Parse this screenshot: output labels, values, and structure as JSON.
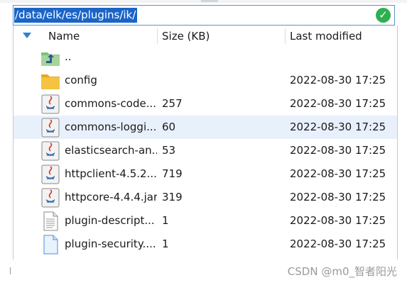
{
  "path": {
    "value": "/data/elk/es/plugins/ik/"
  },
  "columns": {
    "name": "Name",
    "size": "Size (KB)",
    "modified": "Last modified"
  },
  "files": [
    {
      "name": "..",
      "size": "",
      "modified": "",
      "icon": "parent-folder-icon"
    },
    {
      "name": "config",
      "size": "",
      "modified": "2022-08-30 17:25",
      "icon": "folder-icon"
    },
    {
      "name": "commons-code...",
      "size": "257",
      "modified": "2022-08-30 17:25",
      "icon": "java-file-icon"
    },
    {
      "name": "commons-loggi...",
      "size": "60",
      "modified": "2022-08-30 17:25",
      "icon": "java-file-icon"
    },
    {
      "name": "elasticsearch-an...",
      "size": "53",
      "modified": "2022-08-30 17:25",
      "icon": "java-file-icon"
    },
    {
      "name": "httpclient-4.5.2...",
      "size": "719",
      "modified": "2022-08-30 17:25",
      "icon": "java-file-icon"
    },
    {
      "name": "httpcore-4.4.4.jar",
      "size": "319",
      "modified": "2022-08-30 17:25",
      "icon": "java-file-icon"
    },
    {
      "name": "plugin-descript...",
      "size": "1",
      "modified": "2022-08-30 17:25",
      "icon": "text-file-icon"
    },
    {
      "name": "plugin-security....",
      "size": "1",
      "modified": "2022-08-30 17:25",
      "icon": "blank-file-icon"
    }
  ],
  "colors": {
    "selection": "#1a64c8",
    "row_highlight": "#e8f1fb",
    "folder": "#f5c342",
    "ok": "#2db050",
    "sort_arrow": "#2d7fd3"
  },
  "watermark": "CSDN @m0_智者阳光"
}
